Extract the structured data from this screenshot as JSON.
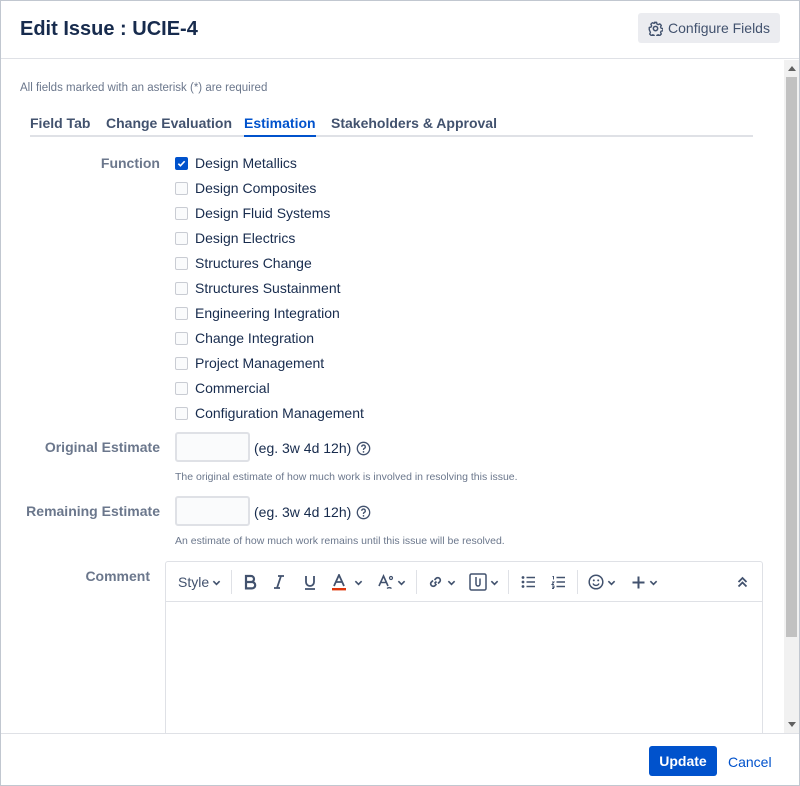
{
  "header": {
    "title": "Edit Issue : UCIE-4",
    "configure_label": "Configure Fields"
  },
  "required_note": "All fields marked with an asterisk (*) are required",
  "tabs": [
    {
      "label": "Field Tab",
      "active": false
    },
    {
      "label": "Change Evaluation",
      "active": false
    },
    {
      "label": "Estimation",
      "active": true
    },
    {
      "label": "Stakeholders & Approval",
      "active": false
    }
  ],
  "function": {
    "label": "Function",
    "options": [
      {
        "label": "Design Metallics",
        "checked": true
      },
      {
        "label": "Design Composites",
        "checked": false
      },
      {
        "label": "Design Fluid Systems",
        "checked": false
      },
      {
        "label": "Design Electrics",
        "checked": false
      },
      {
        "label": "Structures Change",
        "checked": false
      },
      {
        "label": "Structures Sustainment",
        "checked": false
      },
      {
        "label": "Engineering Integration",
        "checked": false
      },
      {
        "label": "Change Integration",
        "checked": false
      },
      {
        "label": "Project Management",
        "checked": false
      },
      {
        "label": "Commercial",
        "checked": false
      },
      {
        "label": "Configuration Management",
        "checked": false
      }
    ]
  },
  "original_estimate": {
    "label": "Original Estimate",
    "value": "",
    "hint": "(eg. 3w 4d 12h)",
    "description": "The original estimate of how much work is involved in resolving this issue."
  },
  "remaining_estimate": {
    "label": "Remaining Estimate",
    "value": "",
    "hint": "(eg. 3w 4d 12h)",
    "description": "An estimate of how much work remains until this issue will be resolved."
  },
  "comment": {
    "label": "Comment",
    "style_label": "Style"
  },
  "footer": {
    "update_label": "Update",
    "cancel_label": "Cancel"
  },
  "colors": {
    "primary": "#0052cc",
    "text": "#172b4d",
    "muted": "#6b778c"
  }
}
